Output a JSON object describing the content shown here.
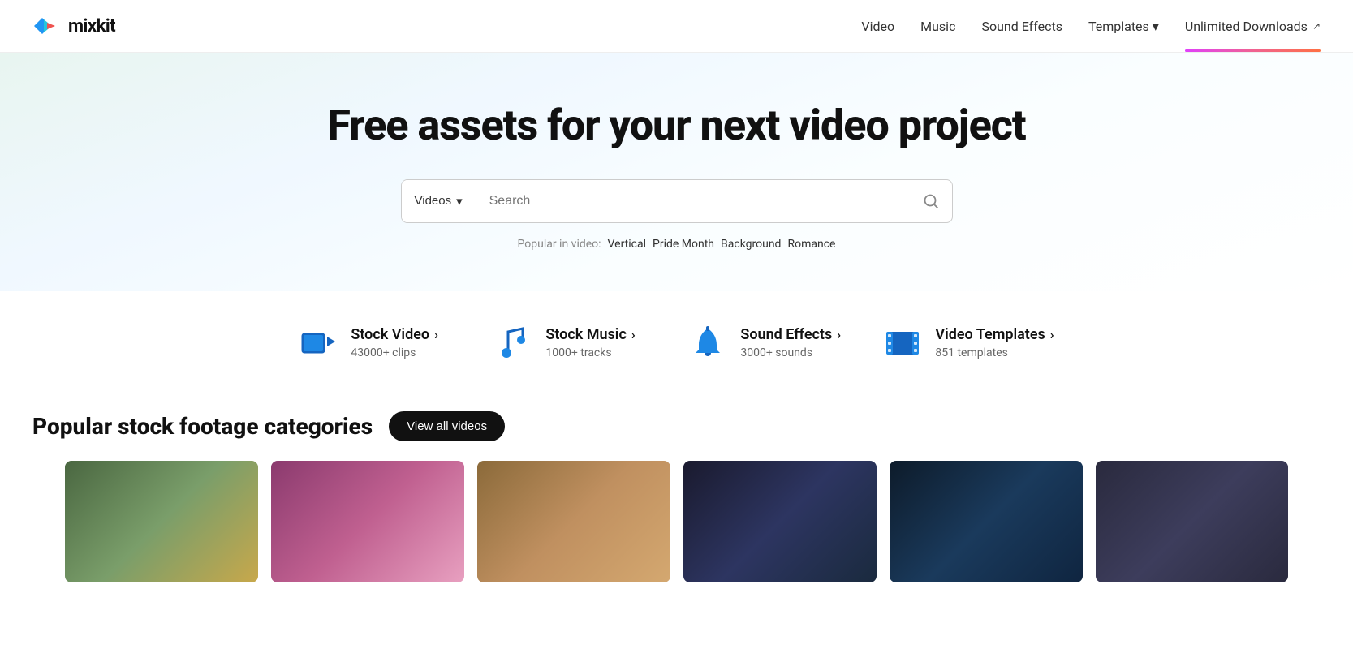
{
  "header": {
    "logo_text": "mixkit",
    "nav": [
      {
        "id": "video",
        "label": "Video"
      },
      {
        "id": "music",
        "label": "Music"
      },
      {
        "id": "sound-effects",
        "label": "Sound Effects"
      },
      {
        "id": "templates",
        "label": "Templates",
        "has_dropdown": true
      },
      {
        "id": "unlimited-downloads",
        "label": "Unlimited Downloads",
        "has_external": true,
        "has_underline": true
      }
    ]
  },
  "hero": {
    "title": "Free assets for your next video project",
    "search": {
      "type_label": "Videos",
      "placeholder": "Search",
      "dropdown_icon": "▾"
    },
    "popular": {
      "label": "Popular in video:",
      "tags": [
        "Vertical",
        "Pride Month",
        "Background",
        "Romance"
      ]
    }
  },
  "categories": [
    {
      "id": "stock-video",
      "title": "Stock Video",
      "count": "43000+ clips",
      "icon_type": "video"
    },
    {
      "id": "stock-music",
      "title": "Stock Music",
      "count": "1000+ tracks",
      "icon_type": "music"
    },
    {
      "id": "sound-effects",
      "title": "Sound Effects",
      "count": "3000+ sounds",
      "icon_type": "bell"
    },
    {
      "id": "video-templates",
      "title": "Video Templates",
      "count": "851 templates",
      "icon_type": "film"
    }
  ],
  "popular_section": {
    "title": "Popular stock footage categories",
    "view_all_label": "View all videos"
  },
  "video_thumbs": [
    {
      "id": "thumb-1",
      "class": "thumb-1"
    },
    {
      "id": "thumb-2",
      "class": "thumb-2"
    },
    {
      "id": "thumb-3",
      "class": "thumb-3"
    },
    {
      "id": "thumb-4",
      "class": "thumb-4"
    },
    {
      "id": "thumb-5",
      "class": "thumb-5"
    },
    {
      "id": "thumb-6",
      "class": "thumb-6"
    }
  ]
}
